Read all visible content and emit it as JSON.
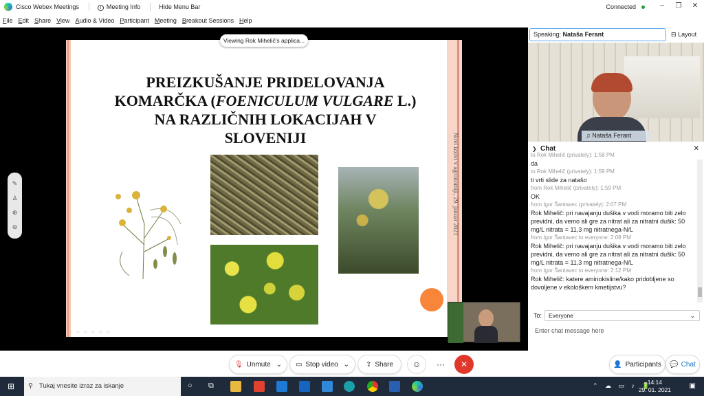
{
  "window": {
    "app_title": "Cisco Webex Meetings",
    "meeting_info": "Meeting Info",
    "hide_menu": "Hide Menu Bar",
    "status": "Connected"
  },
  "menu": [
    "File",
    "Edit",
    "Share",
    "View",
    "Audio & Video",
    "Participant",
    "Meeting",
    "Breakout Sessions",
    "Help"
  ],
  "share": {
    "viewing_label": "Viewing Rok Mihelič's applica..."
  },
  "slide": {
    "title_lines": [
      "PREIZKUŠANJE PRIDELOVANJA",
      "KOMARČKA (",
      "FOENICULUM VULGARE",
      " L.)",
      "NA RAZLIČNIH LOKACIJAH V",
      "SLOVENIJI"
    ],
    "side_text": "Novi izzivi v agronomiji, 29. januar 2021"
  },
  "controls": {
    "unmute": "Unmute",
    "stop_video": "Stop video",
    "share": "Share",
    "participants": "Participants",
    "chat": "Chat"
  },
  "panel": {
    "speaking_prefix": "Speaking:",
    "speaker": "Nataša Ferant",
    "layout": "Layout",
    "video_name": "Nataša Ferant",
    "chat_title": "Chat",
    "to_label": "To:",
    "to_value": "Everyone",
    "input_placeholder": "Enter chat message here"
  },
  "chat": [
    {
      "meta": "to Rok Mihelič (privately):   1:58 PM",
      "msg": "da"
    },
    {
      "meta": "to Rok Mihelič (privately):   1:59 PM",
      "msg": "ti vrti slide za natašo"
    },
    {
      "meta": "from Rok Mihelič (privately):   1:59 PM",
      "msg": "OK"
    },
    {
      "meta": "from Igor Šantavec (privately):   2:07 PM",
      "msg": "Rok Mihelič: pri navajanju dušika v vodi moramo biti zelo previdni, da vemo ali gre za nitrat ali za nitratni dušik: 50 mg/L nitrata = 11,3 mg nitratnega-N/L"
    },
    {
      "meta": "from Igor Šantavec to everyone:   2:08 PM",
      "msg": "Rok Mihelič: pri navajanju dušika v vodi moramo biti zelo previdni, da vemo ali gre za nitrat ali za nitratni dušik: 50 mg/L nitrata = 11,3 mg nitratnega-N/L"
    },
    {
      "meta": "from Igor Šantavec to everyone:   2:12 PM",
      "msg": "Rok Mihelič: katere aminokisline/kako pridobljene so dovoljene v ekološkem kmetijstvu?"
    }
  ],
  "taskbar": {
    "search_placeholder": "Tukaj vnesite izraz za iskanje",
    "time": "14:14",
    "date": "29. 01. 2021"
  }
}
